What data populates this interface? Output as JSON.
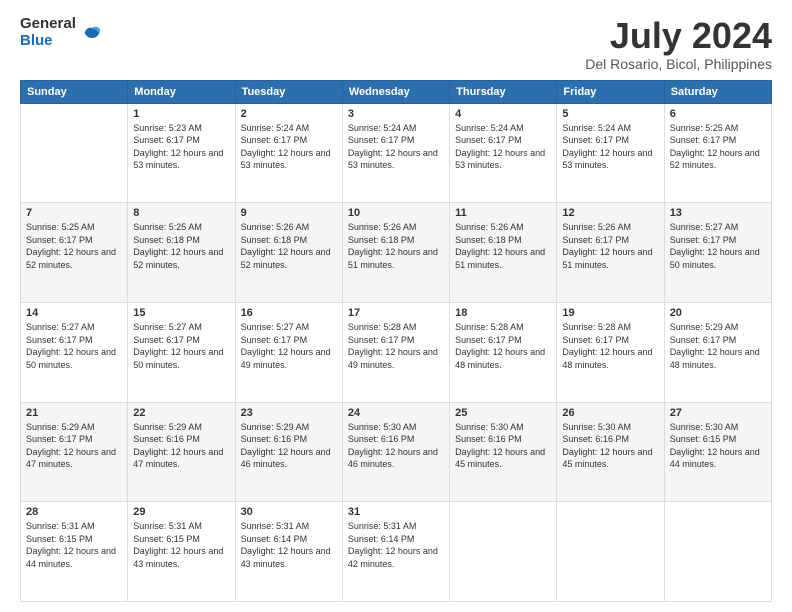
{
  "header": {
    "logo_general": "General",
    "logo_blue": "Blue",
    "title": "July 2024",
    "subtitle": "Del Rosario, Bicol, Philippines"
  },
  "calendar": {
    "days_of_week": [
      "Sunday",
      "Monday",
      "Tuesday",
      "Wednesday",
      "Thursday",
      "Friday",
      "Saturday"
    ],
    "weeks": [
      [
        {
          "day": "",
          "sunrise": "",
          "sunset": "",
          "daylight": ""
        },
        {
          "day": "1",
          "sunrise": "Sunrise: 5:23 AM",
          "sunset": "Sunset: 6:17 PM",
          "daylight": "Daylight: 12 hours and 53 minutes."
        },
        {
          "day": "2",
          "sunrise": "Sunrise: 5:24 AM",
          "sunset": "Sunset: 6:17 PM",
          "daylight": "Daylight: 12 hours and 53 minutes."
        },
        {
          "day": "3",
          "sunrise": "Sunrise: 5:24 AM",
          "sunset": "Sunset: 6:17 PM",
          "daylight": "Daylight: 12 hours and 53 minutes."
        },
        {
          "day": "4",
          "sunrise": "Sunrise: 5:24 AM",
          "sunset": "Sunset: 6:17 PM",
          "daylight": "Daylight: 12 hours and 53 minutes."
        },
        {
          "day": "5",
          "sunrise": "Sunrise: 5:24 AM",
          "sunset": "Sunset: 6:17 PM",
          "daylight": "Daylight: 12 hours and 53 minutes."
        },
        {
          "day": "6",
          "sunrise": "Sunrise: 5:25 AM",
          "sunset": "Sunset: 6:17 PM",
          "daylight": "Daylight: 12 hours and 52 minutes."
        }
      ],
      [
        {
          "day": "7",
          "sunrise": "Sunrise: 5:25 AM",
          "sunset": "Sunset: 6:17 PM",
          "daylight": "Daylight: 12 hours and 52 minutes."
        },
        {
          "day": "8",
          "sunrise": "Sunrise: 5:25 AM",
          "sunset": "Sunset: 6:18 PM",
          "daylight": "Daylight: 12 hours and 52 minutes."
        },
        {
          "day": "9",
          "sunrise": "Sunrise: 5:26 AM",
          "sunset": "Sunset: 6:18 PM",
          "daylight": "Daylight: 12 hours and 52 minutes."
        },
        {
          "day": "10",
          "sunrise": "Sunrise: 5:26 AM",
          "sunset": "Sunset: 6:18 PM",
          "daylight": "Daylight: 12 hours and 51 minutes."
        },
        {
          "day": "11",
          "sunrise": "Sunrise: 5:26 AM",
          "sunset": "Sunset: 6:18 PM",
          "daylight": "Daylight: 12 hours and 51 minutes."
        },
        {
          "day": "12",
          "sunrise": "Sunrise: 5:26 AM",
          "sunset": "Sunset: 6:17 PM",
          "daylight": "Daylight: 12 hours and 51 minutes."
        },
        {
          "day": "13",
          "sunrise": "Sunrise: 5:27 AM",
          "sunset": "Sunset: 6:17 PM",
          "daylight": "Daylight: 12 hours and 50 minutes."
        }
      ],
      [
        {
          "day": "14",
          "sunrise": "Sunrise: 5:27 AM",
          "sunset": "Sunset: 6:17 PM",
          "daylight": "Daylight: 12 hours and 50 minutes."
        },
        {
          "day": "15",
          "sunrise": "Sunrise: 5:27 AM",
          "sunset": "Sunset: 6:17 PM",
          "daylight": "Daylight: 12 hours and 50 minutes."
        },
        {
          "day": "16",
          "sunrise": "Sunrise: 5:27 AM",
          "sunset": "Sunset: 6:17 PM",
          "daylight": "Daylight: 12 hours and 49 minutes."
        },
        {
          "day": "17",
          "sunrise": "Sunrise: 5:28 AM",
          "sunset": "Sunset: 6:17 PM",
          "daylight": "Daylight: 12 hours and 49 minutes."
        },
        {
          "day": "18",
          "sunrise": "Sunrise: 5:28 AM",
          "sunset": "Sunset: 6:17 PM",
          "daylight": "Daylight: 12 hours and 48 minutes."
        },
        {
          "day": "19",
          "sunrise": "Sunrise: 5:28 AM",
          "sunset": "Sunset: 6:17 PM",
          "daylight": "Daylight: 12 hours and 48 minutes."
        },
        {
          "day": "20",
          "sunrise": "Sunrise: 5:29 AM",
          "sunset": "Sunset: 6:17 PM",
          "daylight": "Daylight: 12 hours and 48 minutes."
        }
      ],
      [
        {
          "day": "21",
          "sunrise": "Sunrise: 5:29 AM",
          "sunset": "Sunset: 6:17 PM",
          "daylight": "Daylight: 12 hours and 47 minutes."
        },
        {
          "day": "22",
          "sunrise": "Sunrise: 5:29 AM",
          "sunset": "Sunset: 6:16 PM",
          "daylight": "Daylight: 12 hours and 47 minutes."
        },
        {
          "day": "23",
          "sunrise": "Sunrise: 5:29 AM",
          "sunset": "Sunset: 6:16 PM",
          "daylight": "Daylight: 12 hours and 46 minutes."
        },
        {
          "day": "24",
          "sunrise": "Sunrise: 5:30 AM",
          "sunset": "Sunset: 6:16 PM",
          "daylight": "Daylight: 12 hours and 46 minutes."
        },
        {
          "day": "25",
          "sunrise": "Sunrise: 5:30 AM",
          "sunset": "Sunset: 6:16 PM",
          "daylight": "Daylight: 12 hours and 45 minutes."
        },
        {
          "day": "26",
          "sunrise": "Sunrise: 5:30 AM",
          "sunset": "Sunset: 6:16 PM",
          "daylight": "Daylight: 12 hours and 45 minutes."
        },
        {
          "day": "27",
          "sunrise": "Sunrise: 5:30 AM",
          "sunset": "Sunset: 6:15 PM",
          "daylight": "Daylight: 12 hours and 44 minutes."
        }
      ],
      [
        {
          "day": "28",
          "sunrise": "Sunrise: 5:31 AM",
          "sunset": "Sunset: 6:15 PM",
          "daylight": "Daylight: 12 hours and 44 minutes."
        },
        {
          "day": "29",
          "sunrise": "Sunrise: 5:31 AM",
          "sunset": "Sunset: 6:15 PM",
          "daylight": "Daylight: 12 hours and 43 minutes."
        },
        {
          "day": "30",
          "sunrise": "Sunrise: 5:31 AM",
          "sunset": "Sunset: 6:14 PM",
          "daylight": "Daylight: 12 hours and 43 minutes."
        },
        {
          "day": "31",
          "sunrise": "Sunrise: 5:31 AM",
          "sunset": "Sunset: 6:14 PM",
          "daylight": "Daylight: 12 hours and 42 minutes."
        },
        {
          "day": "",
          "sunrise": "",
          "sunset": "",
          "daylight": ""
        },
        {
          "day": "",
          "sunrise": "",
          "sunset": "",
          "daylight": ""
        },
        {
          "day": "",
          "sunrise": "",
          "sunset": "",
          "daylight": ""
        }
      ]
    ]
  }
}
